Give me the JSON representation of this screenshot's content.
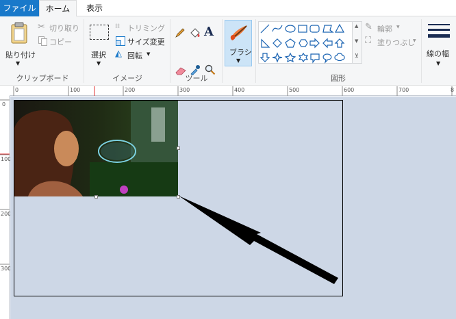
{
  "menu": {
    "file": "ファイル",
    "home": "ホーム",
    "view": "表示"
  },
  "clipboard": {
    "paste": "貼り付け",
    "cut": "切り取り",
    "copy": "コピー",
    "group": "クリップボード"
  },
  "image": {
    "select": "選択",
    "crop": "トリミング",
    "resize": "サイズ変更",
    "rotate": "回転",
    "group": "イメージ"
  },
  "tools": {
    "group": "ツール",
    "text_glyph": "A"
  },
  "brush": {
    "label": "ブラシ"
  },
  "shapes": {
    "outline": "輪郭",
    "fill": "塗りつぶし",
    "group": "図形"
  },
  "size": {
    "label": "線の幅"
  },
  "ruler": {
    "h_ticks": [
      "0",
      "100",
      "200",
      "300",
      "400",
      "500",
      "600",
      "700",
      "8"
    ],
    "v_ticks": [
      "0",
      "100",
      "200",
      "300"
    ]
  },
  "colors": {
    "accent": "#1979ca",
    "ribbon": "#f5f6f7",
    "workspace": "#cdd7e6",
    "selected_tool": "#cce4f7",
    "arrow": "#000000"
  }
}
